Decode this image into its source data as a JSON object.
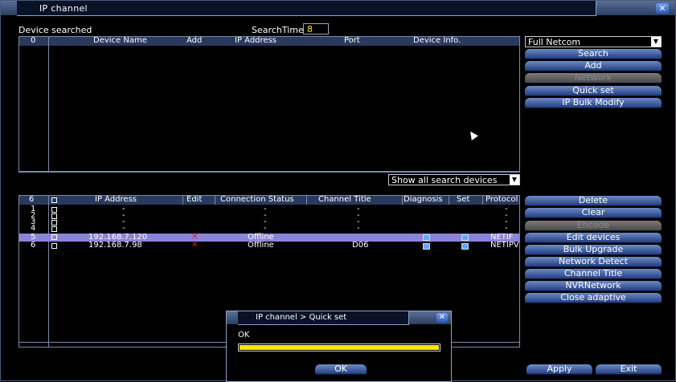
{
  "window": {
    "title": "IP channel"
  },
  "search": {
    "section_label": "Device searched",
    "time_label": "SearchTime",
    "time_value": "8"
  },
  "search_table": {
    "columns": [
      "0",
      "Device Name",
      "Add",
      "IP Address",
      "Port",
      "Device Info."
    ]
  },
  "protocol_select": {
    "value": "Full Netcom"
  },
  "side_buttons_top": [
    {
      "label": "Search",
      "enabled": true
    },
    {
      "label": "Add",
      "enabled": true
    },
    {
      "label": "Network",
      "enabled": false
    },
    {
      "label": "Quick set",
      "enabled": true
    },
    {
      "label": "IP Bulk Modify",
      "enabled": true
    }
  ],
  "filter_select": {
    "value": "Show all search devices"
  },
  "added_table": {
    "count": "6",
    "columns": [
      "IP Address",
      "Edit",
      "Connection Status",
      "Channel Title",
      "Diagnosis",
      "Set",
      "Protocol"
    ],
    "rows": [
      {
        "num": "1",
        "ip": "-",
        "status": "-",
        "title": "-",
        "proto": "-",
        "edit": false,
        "icons": false,
        "selected": false
      },
      {
        "num": "2",
        "ip": "-",
        "status": "-",
        "title": "-",
        "proto": "-",
        "edit": false,
        "icons": false,
        "selected": false
      },
      {
        "num": "3",
        "ip": "-",
        "status": "-",
        "title": "-",
        "proto": "-",
        "edit": false,
        "icons": false,
        "selected": false
      },
      {
        "num": "4",
        "ip": "-",
        "status": "-",
        "title": "-",
        "proto": "-",
        "edit": false,
        "icons": false,
        "selected": false
      },
      {
        "num": "5",
        "ip": "192.168.7.120",
        "status": "Offline",
        "title": "",
        "proto": "NETIF",
        "edit": true,
        "icons": true,
        "selected": true
      },
      {
        "num": "6",
        "ip": "192.168.7.98",
        "status": "Offline",
        "title": "D06",
        "proto": "NETIPV",
        "edit": true,
        "icons": true,
        "selected": false
      }
    ]
  },
  "side_buttons_bottom": [
    {
      "label": "Delete",
      "enabled": true
    },
    {
      "label": "Clear",
      "enabled": true
    },
    {
      "label": "Encode",
      "enabled": false
    },
    {
      "label": "Edit devices",
      "enabled": true
    },
    {
      "label": "Bulk Upgrade",
      "enabled": true
    },
    {
      "label": "Network Detect",
      "enabled": true
    },
    {
      "label": "Channel Title",
      "enabled": true
    },
    {
      "label": "NVRNetwork",
      "enabled": true
    },
    {
      "label": "Close adaptive",
      "enabled": true
    }
  ],
  "footer": {
    "apply_label": "Apply",
    "exit_label": "Exit"
  },
  "dialog": {
    "title": "IP channel > Quick set",
    "message": "OK",
    "progress": 1.0,
    "ok_label": "OK"
  },
  "colors": {
    "accent": "#213d82",
    "selected_row": "#8c84d8",
    "progress_fill": "#f5e800",
    "delete_mark": "#e02020"
  }
}
